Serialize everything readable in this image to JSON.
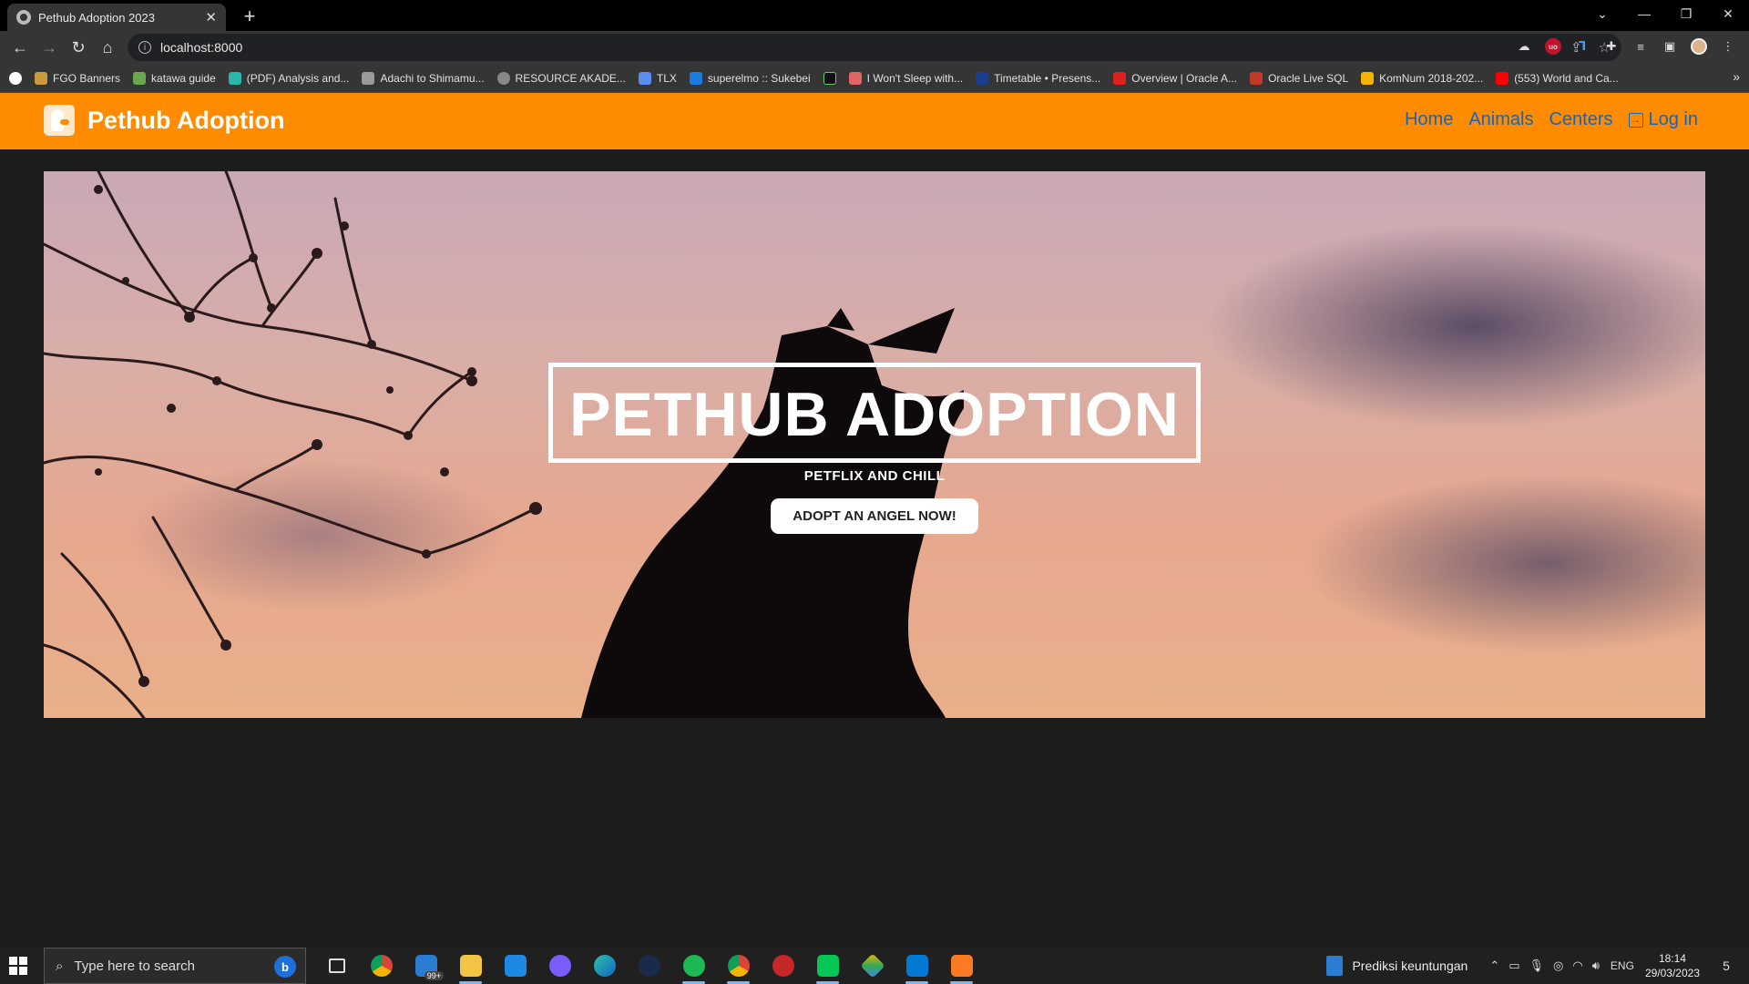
{
  "browser": {
    "tab_title": "Pethub Adoption 2023",
    "close_glyph": "✕",
    "new_tab_glyph": "+",
    "url": "localhost:8000",
    "bookmarks": [
      {
        "label": "FGO Banners",
        "color": "#c89b3c"
      },
      {
        "label": "katawa guide",
        "color": "#6aa84f"
      },
      {
        "label": "(PDF) Analysis and...",
        "color": "#2ab7a9"
      },
      {
        "label": "Adachi to Shimamu...",
        "color": "#999999"
      },
      {
        "label": "RESOURCE AKADE...",
        "color": "#888888"
      },
      {
        "label": "TLX",
        "color": "#5b8def"
      },
      {
        "label": "superelmo :: Sukebei",
        "color": "#1d7be0"
      },
      {
        "label": "",
        "color": "#111111"
      },
      {
        "label": "I Won't Sleep with...",
        "color": "#e06666"
      },
      {
        "label": "Timetable • Presens...",
        "color": "#1a3d8f"
      },
      {
        "label": "Overview | Oracle A...",
        "color": "#e02020"
      },
      {
        "label": "Oracle Live SQL",
        "color": "#c0392b"
      },
      {
        "label": "KomNum 2018-202...",
        "color": "#f4b400"
      },
      {
        "label": "(553) World and Ca...",
        "color": "#ff0000"
      }
    ]
  },
  "site": {
    "brand": "Pethub Adoption",
    "nav": {
      "home": "Home",
      "animals": "Animals",
      "centers": "Centers",
      "login": "Log in"
    },
    "hero": {
      "title": "PETHUB ADOPTION",
      "subtitle": "PETFLIX AND CHILL",
      "cta": "ADOPT AN ANGEL NOW!"
    },
    "colors": {
      "navbar": "#ff8c00",
      "nav_link": "#1565c0",
      "page_bg": "#1c1c1c"
    }
  },
  "taskbar": {
    "search_placeholder": "Type here to search",
    "mail_badge": "99+",
    "running_task": "Prediksi keuntungan",
    "language": "ENG",
    "time": "18:14",
    "date": "29/03/2023",
    "notification_count": "5"
  }
}
